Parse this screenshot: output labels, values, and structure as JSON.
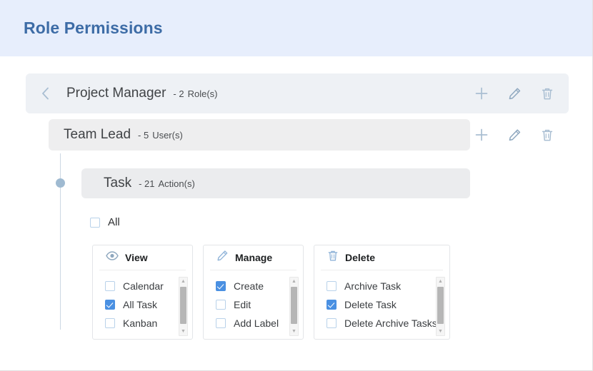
{
  "header": {
    "title": "Role Permissions",
    "band_color": "#e7eefc",
    "title_color": "#3d6ca6"
  },
  "rows": {
    "project_manager": {
      "name": "Project Manager",
      "count": "- 2",
      "unit": "Role(s)",
      "back_icon": "chevron-left-icon",
      "actions": [
        "plus-icon",
        "pencil-icon",
        "trash-icon"
      ]
    },
    "team_lead": {
      "name": "Team Lead",
      "count": "- 5",
      "unit": "User(s)",
      "actions": [
        "plus-icon",
        "pencil-icon",
        "trash-icon"
      ]
    },
    "task": {
      "name": "Task",
      "count": "- 21",
      "unit": "Action(s)"
    }
  },
  "all_checkbox": {
    "label": "All",
    "checked": false
  },
  "cards": [
    {
      "id": "view",
      "icon": "eye-icon",
      "title": "View",
      "options": [
        {
          "label": "Calendar",
          "checked": false
        },
        {
          "label": "All Task",
          "checked": true
        },
        {
          "label": "Kanban",
          "checked": false
        }
      ]
    },
    {
      "id": "manage",
      "icon": "pencil-icon",
      "title": "Manage",
      "options": [
        {
          "label": "Create",
          "checked": true
        },
        {
          "label": "Edit",
          "checked": false
        },
        {
          "label": "Add Label",
          "checked": false
        }
      ]
    },
    {
      "id": "delete",
      "icon": "trash-icon",
      "title": "Delete",
      "options": [
        {
          "label": "Archive Task",
          "checked": false
        },
        {
          "label": "Delete Task",
          "checked": true
        },
        {
          "label": "Delete Archive Tasks",
          "checked": false
        }
      ]
    }
  ],
  "colors": {
    "accent_blue": "#4a90e2",
    "icon_muted": "#a9bed2",
    "row_bg": "#eef1f5"
  }
}
